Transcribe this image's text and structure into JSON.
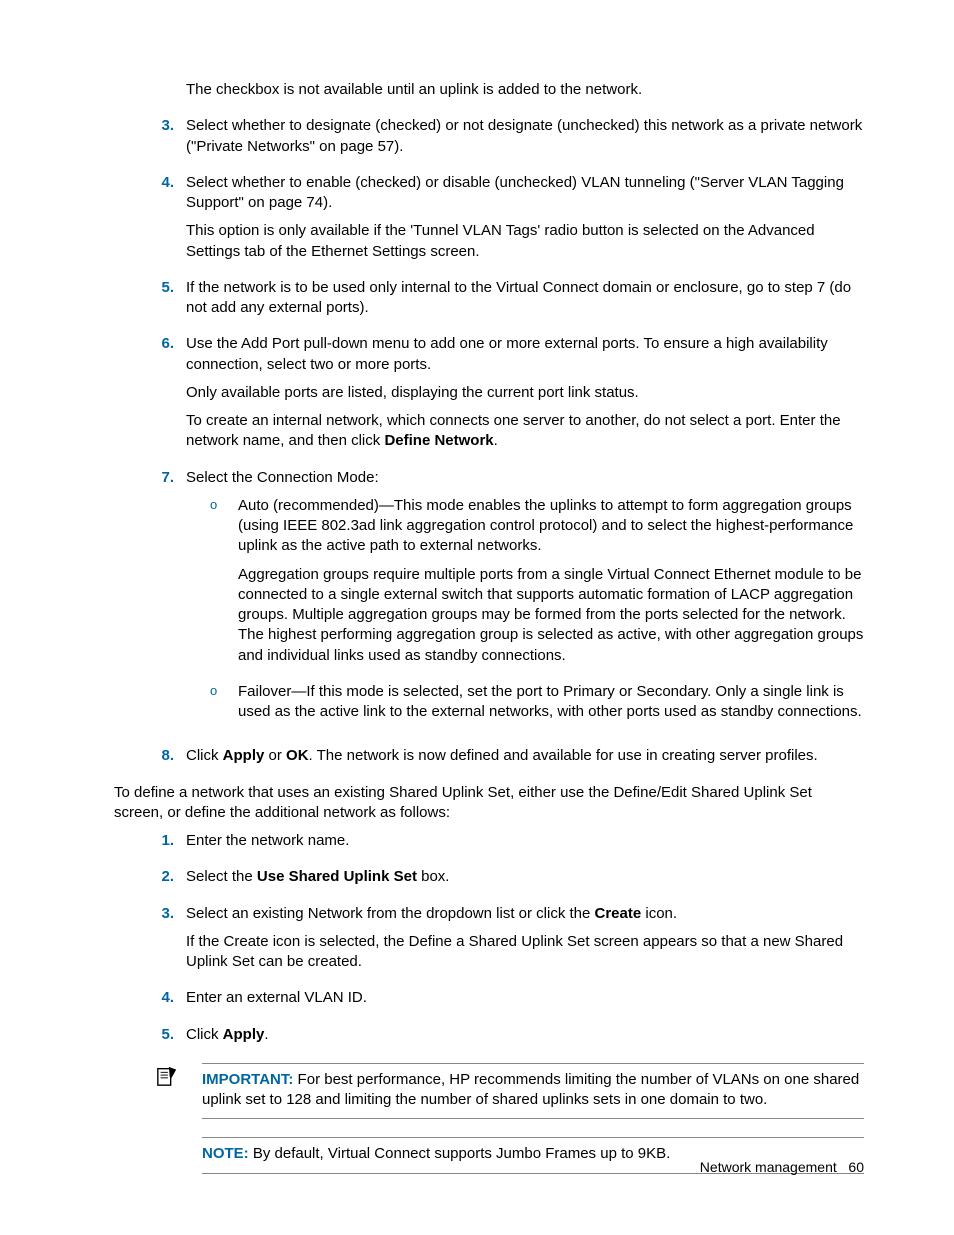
{
  "intro": {
    "p1": "The checkbox is not available until an uplink is added to the network."
  },
  "list1": {
    "i3": {
      "num": "3.",
      "p1_a": "Select whether to designate (checked) or not designate (unchecked) this network as a private network (\"Private Networks\" on page ",
      "p1_page": "57",
      "p1_b": ")."
    },
    "i4": {
      "num": "4.",
      "p1_a": "Select whether to enable (checked) or disable (unchecked) VLAN tunneling (\"Server VLAN Tagging Support\" on page ",
      "p1_page": "74",
      "p1_b": ").",
      "p2": "This option is only available if the 'Tunnel VLAN Tags' radio button is selected on the Advanced Settings tab of the Ethernet Settings screen."
    },
    "i5": {
      "num": "5.",
      "p1": "If the network is to be used only internal to the Virtual Connect domain or enclosure, go to step 7 (do not add any external ports)."
    },
    "i6": {
      "num": "6.",
      "p1": "Use the Add Port pull-down menu to add one or more external ports. To ensure a high availability connection, select two or more ports.",
      "p2": "Only available ports are listed, displaying the current port link status.",
      "p3_a": "To create an internal network, which connects one server to another, do not select a port. Enter the network name, and then click ",
      "p3_b": "Define Network",
      "p3_c": "."
    },
    "i7": {
      "num": "7.",
      "p1": "Select the Connection Mode:",
      "auto": {
        "bullet": "o",
        "p1": "Auto (recommended)—This mode enables the uplinks to attempt to form aggregation groups (using IEEE 802.3ad link aggregation control protocol) and to select the highest-performance uplink as the active path to external networks.",
        "p2": "Aggregation groups require multiple ports from a single Virtual Connect Ethernet module to be connected to a single external switch that supports automatic formation of LACP aggregation groups. Multiple aggregation groups may be formed from the ports selected for the network. The highest performing aggregation group is selected as active, with other aggregation groups and individual links used as standby connections."
      },
      "failover": {
        "bullet": "o",
        "p1": "Failover—If this mode is selected, set the port to Primary or Secondary. Only a single link is used as the active link to the external networks, with other ports used as standby connections."
      }
    },
    "i8": {
      "num": "8.",
      "a": "Click ",
      "b": "Apply",
      "c": " or ",
      "d": "OK",
      "e": ". The network is now defined and available for use in creating server profiles."
    }
  },
  "mid": {
    "p1": "To define a network that uses an existing Shared Uplink Set, either use the Define/Edit Shared Uplink Set screen, or define the additional network as follows:"
  },
  "list2": {
    "i1": {
      "num": "1.",
      "p": "Enter the network name."
    },
    "i2": {
      "num": "2.",
      "a": "Select the ",
      "b": "Use Shared Uplink Set",
      "c": " box."
    },
    "i3": {
      "num": "3.",
      "a": "Select an existing Network from the dropdown list or click the ",
      "b": "Create",
      "c": " icon.",
      "p2": "If the Create icon is selected, the Define a Shared Uplink Set screen appears so that a new Shared Uplink Set can be created."
    },
    "i4": {
      "num": "4.",
      "p": "Enter an external VLAN ID."
    },
    "i5": {
      "num": "5.",
      "a": "Click ",
      "b": "Apply",
      "c": "."
    }
  },
  "callouts": {
    "important": {
      "label": "IMPORTANT:",
      "text": "  For best performance, HP recommends limiting the number of VLANs on one shared uplink set to 128 and limiting the number of shared uplinks sets in one domain to two."
    },
    "note": {
      "label": "NOTE:",
      "text": "  By default, Virtual Connect supports Jumbo Frames up to 9KB."
    }
  },
  "footer": {
    "section": "Network management",
    "page": "60"
  }
}
